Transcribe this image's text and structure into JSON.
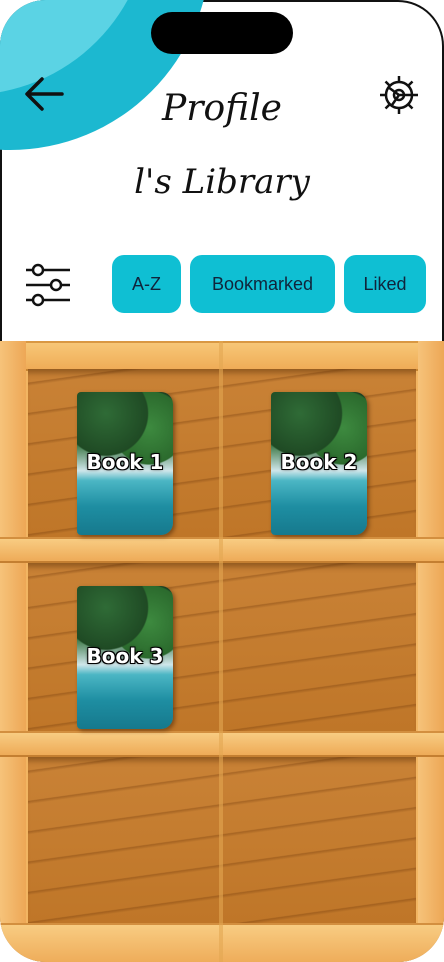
{
  "header": {
    "title": "Profile",
    "back_icon": "arrow-left-icon",
    "settings_icon": "gear-icon"
  },
  "library": {
    "title": "l's Library"
  },
  "toolbar": {
    "filter_icon": "sliders-icon",
    "sort_buttons": [
      {
        "label": "A-Z"
      },
      {
        "label": "Bookmarked"
      },
      {
        "label": "Liked"
      }
    ]
  },
  "bookshelf": {
    "books": [
      {
        "title": "Book 1"
      },
      {
        "title": "Book 2"
      },
      {
        "title": "Book 3"
      }
    ]
  },
  "colors": {
    "accent": "#0fbfd3",
    "accent_light": "#5bd3e4",
    "shelf_wood": "#f2b562",
    "shelf_back": "#c27a2c"
  }
}
